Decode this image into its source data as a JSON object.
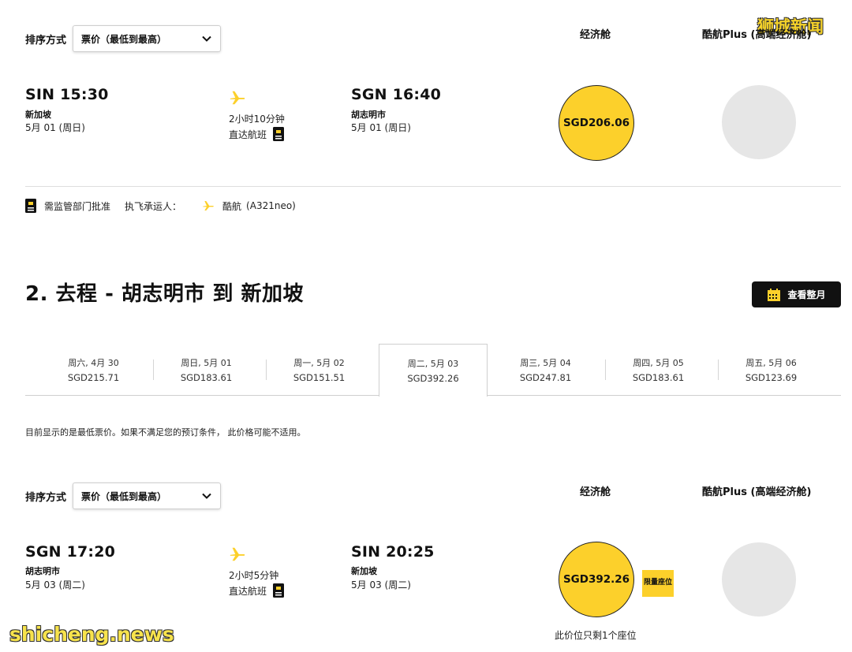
{
  "watermark_top": "狮城新闻",
  "watermark_bottom": "shicheng.news",
  "sort": {
    "label": "排序方式",
    "selected": "票价（最低到最高）"
  },
  "columns": {
    "economy": "经济舱",
    "plus": "酷航Plus (高端经济舱)"
  },
  "flight1": {
    "dep_time": "SIN 15:30",
    "dep_city": "新加坡",
    "dep_date": "5月 01 (周日)",
    "duration": "2小时10分钟",
    "type": "直达航班",
    "arr_time": "SGN 16:40",
    "arr_city": "胡志明市",
    "arr_date": "5月 01 (周日)",
    "economy_price": "SGD206.06"
  },
  "info": {
    "approval": "需监管部门批准",
    "operator_label": "执飞承运人：",
    "operator": "酷航",
    "aircraft": "(A321neo)"
  },
  "section2": {
    "title": "2. 去程 - 胡志明市 到 新加坡",
    "month_button": "查看整月"
  },
  "date_tabs": [
    {
      "day": "周六, 4月 30",
      "price": "SGD215.71"
    },
    {
      "day": "周日, 5月 01",
      "price": "SGD183.61"
    },
    {
      "day": "周一, 5月 02",
      "price": "SGD151.51"
    },
    {
      "day": "周二, 5月 03",
      "price": "SGD392.26"
    },
    {
      "day": "周三, 5月 04",
      "price": "SGD247.81"
    },
    {
      "day": "周四, 5月 05",
      "price": "SGD183.61"
    },
    {
      "day": "周五, 5月 06",
      "price": "SGD123.69"
    }
  ],
  "active_tab_index": 3,
  "note": "目前显示的是最低票价。如果不满足您的预订条件， 此价格可能不适用。",
  "flight2": {
    "dep_time": "SGN 17:20",
    "dep_city": "胡志明市",
    "dep_date": "5月 03 (周二)",
    "duration": "2小时5分钟",
    "type": "直达航班",
    "arr_time": "SIN 20:25",
    "arr_city": "新加坡",
    "arr_date": "5月 03 (周二)",
    "economy_price": "SGD392.26",
    "limited_label": "限量座位",
    "remaining": "此价位只剩1个座位"
  },
  "colors": {
    "accent_yellow": "#fcd02b",
    "dark": "#111111",
    "grey_circle": "#e6e6e6"
  }
}
